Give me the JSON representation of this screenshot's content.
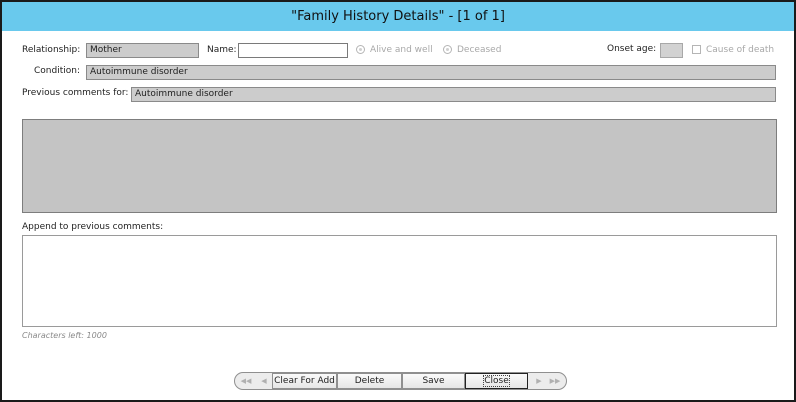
{
  "window": {
    "title": "\"Family History Details\" - [1 of 1]"
  },
  "form": {
    "relationship_label": "Relationship:",
    "relationship_value": "Mother",
    "name_label": "Name:",
    "name_value": "",
    "alive_label": "Alive and well",
    "deceased_label": "Deceased",
    "onset_age_label": "Onset age:",
    "onset_age_value": "",
    "cause_of_death_label": "Cause of death",
    "condition_label": "Condition:",
    "condition_value": "Autoimmune disorder",
    "previous_comments_label": "Previous comments for:",
    "previous_comments_for_value": "Autoimmune disorder",
    "previous_comments_text": "",
    "append_label": "Append to previous comments:",
    "append_value": "",
    "characters_left": "Characters left: 1000"
  },
  "toolbar": {
    "first_icon": "◀◀",
    "prev_icon": "◀",
    "clear_for_add": "Clear For Add",
    "delete": "Delete",
    "save": "Save",
    "close": "Close",
    "next_icon": "▶",
    "last_icon": "▶▶"
  }
}
